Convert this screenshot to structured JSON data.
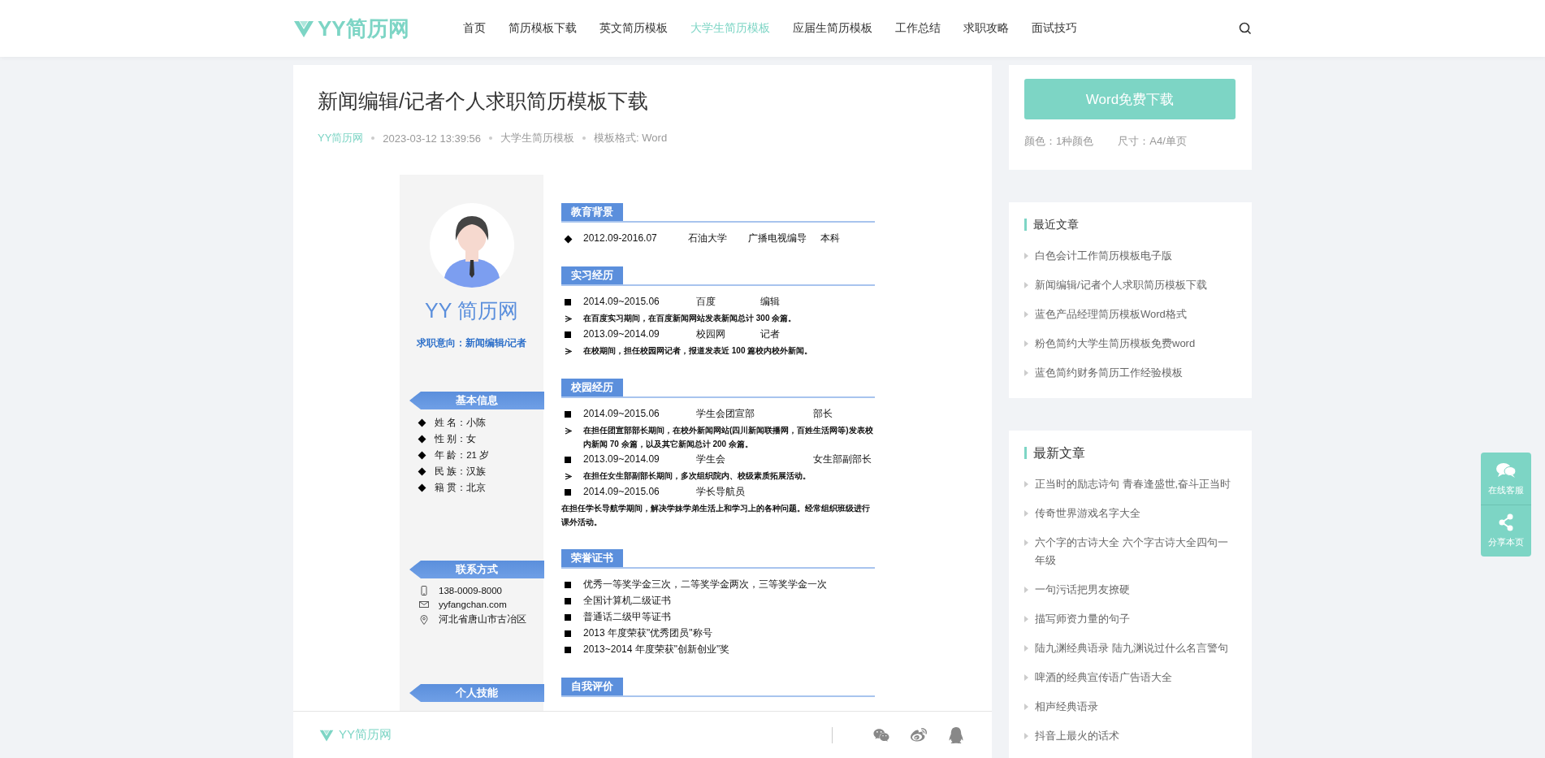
{
  "header": {
    "logo": "YY简历网",
    "nav": [
      {
        "label": "首页",
        "selected": false
      },
      {
        "label": "简历模板下载",
        "selected": false
      },
      {
        "label": "英文简历模板",
        "selected": false
      },
      {
        "label": "大学生简历模板",
        "selected": true
      },
      {
        "label": "应届生简历模板",
        "selected": false
      },
      {
        "label": "工作总结",
        "selected": false
      },
      {
        "label": "求职攻略",
        "selected": false
      },
      {
        "label": "面试技巧",
        "selected": false
      }
    ]
  },
  "article": {
    "title": "新闻编辑/记者个人求职简历模板下载",
    "meta": [
      {
        "text": "YY简历网",
        "kind": "link"
      },
      {
        "text": "2023-03-12 13:39:56",
        "kind": "text"
      },
      {
        "text": "大学生简历模板",
        "kind": "text"
      },
      {
        "text": "模板格式: Word",
        "kind": "text"
      }
    ],
    "resume": {
      "name": "YY 简历网",
      "objective": "求职意向：新闻编辑/记者",
      "left_sections": [
        {
          "title": "基本信息",
          "kind": "facts",
          "items": [
            {
              "text": "姓 名：小陈"
            },
            {
              "text": "性 别：女"
            },
            {
              "text": "年 龄：21 岁"
            },
            {
              "text": "民 族：汉族"
            },
            {
              "text": "籍 贯：北京"
            }
          ]
        },
        {
          "title": "联系方式",
          "kind": "contacts",
          "items": [
            {
              "kind": "phone",
              "text": "138-0009-8000"
            },
            {
              "kind": "email",
              "text": "yyfangchan.com"
            },
            {
              "kind": "location",
              "text": "河北省唐山市古冶区"
            }
          ]
        },
        {
          "title": "个人技能"
        }
      ],
      "right_sections": [
        {
          "title": "教育背景",
          "items": [
            {
              "kind": "diamond",
              "cols": [
                "2012.09-2016.07",
                "石油大学",
                "广播电视编导",
                "本科"
              ]
            }
          ]
        },
        {
          "title": "实习经历",
          "items": [
            {
              "kind": "square",
              "cols": [
                "2014.09~2015.06",
                "百度",
                "编辑"
              ]
            },
            {
              "kind": "arrow",
              "text": "在百度实习期间，在百度新闻网站发表新闻总计 300 余篇。"
            },
            {
              "kind": "square",
              "cols": [
                "2013.09~2014.09",
                "校园网",
                "记者"
              ]
            },
            {
              "kind": "arrow",
              "text": "在校期间，担任校园网记者，报道发表近 100 篇校内校外新闻。"
            }
          ]
        },
        {
          "title": "校园经历",
          "items": [
            {
              "kind": "square",
              "cols": [
                "2014.09~2015.06",
                "学生会团宣部",
                "部长"
              ]
            },
            {
              "kind": "arrow",
              "text": "在担任团宣部部长期间，在校外新闻网站(四川新闻联播网，百姓生活网等)发表校内新闻 70 余篇，以及其它新闻总计 200 余篇。"
            },
            {
              "kind": "square",
              "cols": [
                "2013.09~2014.09",
                "学生会",
                "女生部副部长"
              ]
            },
            {
              "kind": "arrow",
              "text": "在担任女生部副部长期间，多次组织院内、校级素质拓展活动。"
            },
            {
              "kind": "square",
              "cols": [
                "2014.09~2015.06",
                "学长导航员"
              ]
            },
            {
              "kind": "plain",
              "text": "在担任学长导航学期间，解决学妹学弟生活上和学习上的各种问题。经常组织班级进行课外活动。"
            }
          ]
        },
        {
          "title": "荣誉证书",
          "items": [
            {
              "kind": "square",
              "cols": [
                "优秀一等奖学金三次，二等奖学金两次，三等奖学金一次"
              ]
            },
            {
              "kind": "square",
              "cols": [
                "全国计算机二级证书"
              ]
            },
            {
              "kind": "square",
              "cols": [
                "普通话二级甲等证书"
              ]
            },
            {
              "kind": "square",
              "cols": [
                "2013 年度荣获\"优秀团员\"称号"
              ]
            },
            {
              "kind": "square",
              "cols": [
                "2013~2014 年度荣获\"创新创业\"奖"
              ]
            }
          ]
        },
        {
          "title": "自我评价"
        }
      ]
    },
    "share_bar": {
      "logo": "YY简历网"
    }
  },
  "sidebar": {
    "download": {
      "button": "Word免费下载",
      "info": [
        "颜色：1种颜色",
        "尺寸：A4/单页"
      ]
    },
    "recent": {
      "title": "最近文章",
      "items": [
        "白色会计工作简历模板电子版",
        "新闻编辑/记者个人求职简历模板下载",
        "蓝色产品经理简历模板Word格式",
        "粉色简约大学生简历模板免费word",
        "蓝色简约财务简历工作经验模板"
      ]
    },
    "latest": {
      "title": "最新文章",
      "items": [
        "正当时的励志诗句 青春逢盛世,奋斗正当时",
        "传奇世界游戏名字大全",
        "六个字的古诗大全 六个字古诗大全四句一年级",
        "一句污话把男友撩硬",
        "描写师资力量的句子",
        "陆九渊经典语录 陆九渊说过什么名言警句",
        "啤酒的经典宣传语广告语大全",
        "相声经典语录",
        "抖音上最火的话术"
      ]
    }
  },
  "float_buttons": [
    {
      "kind": "chat",
      "label": "在线客服"
    },
    {
      "kind": "share",
      "label": "分享本页"
    }
  ]
}
